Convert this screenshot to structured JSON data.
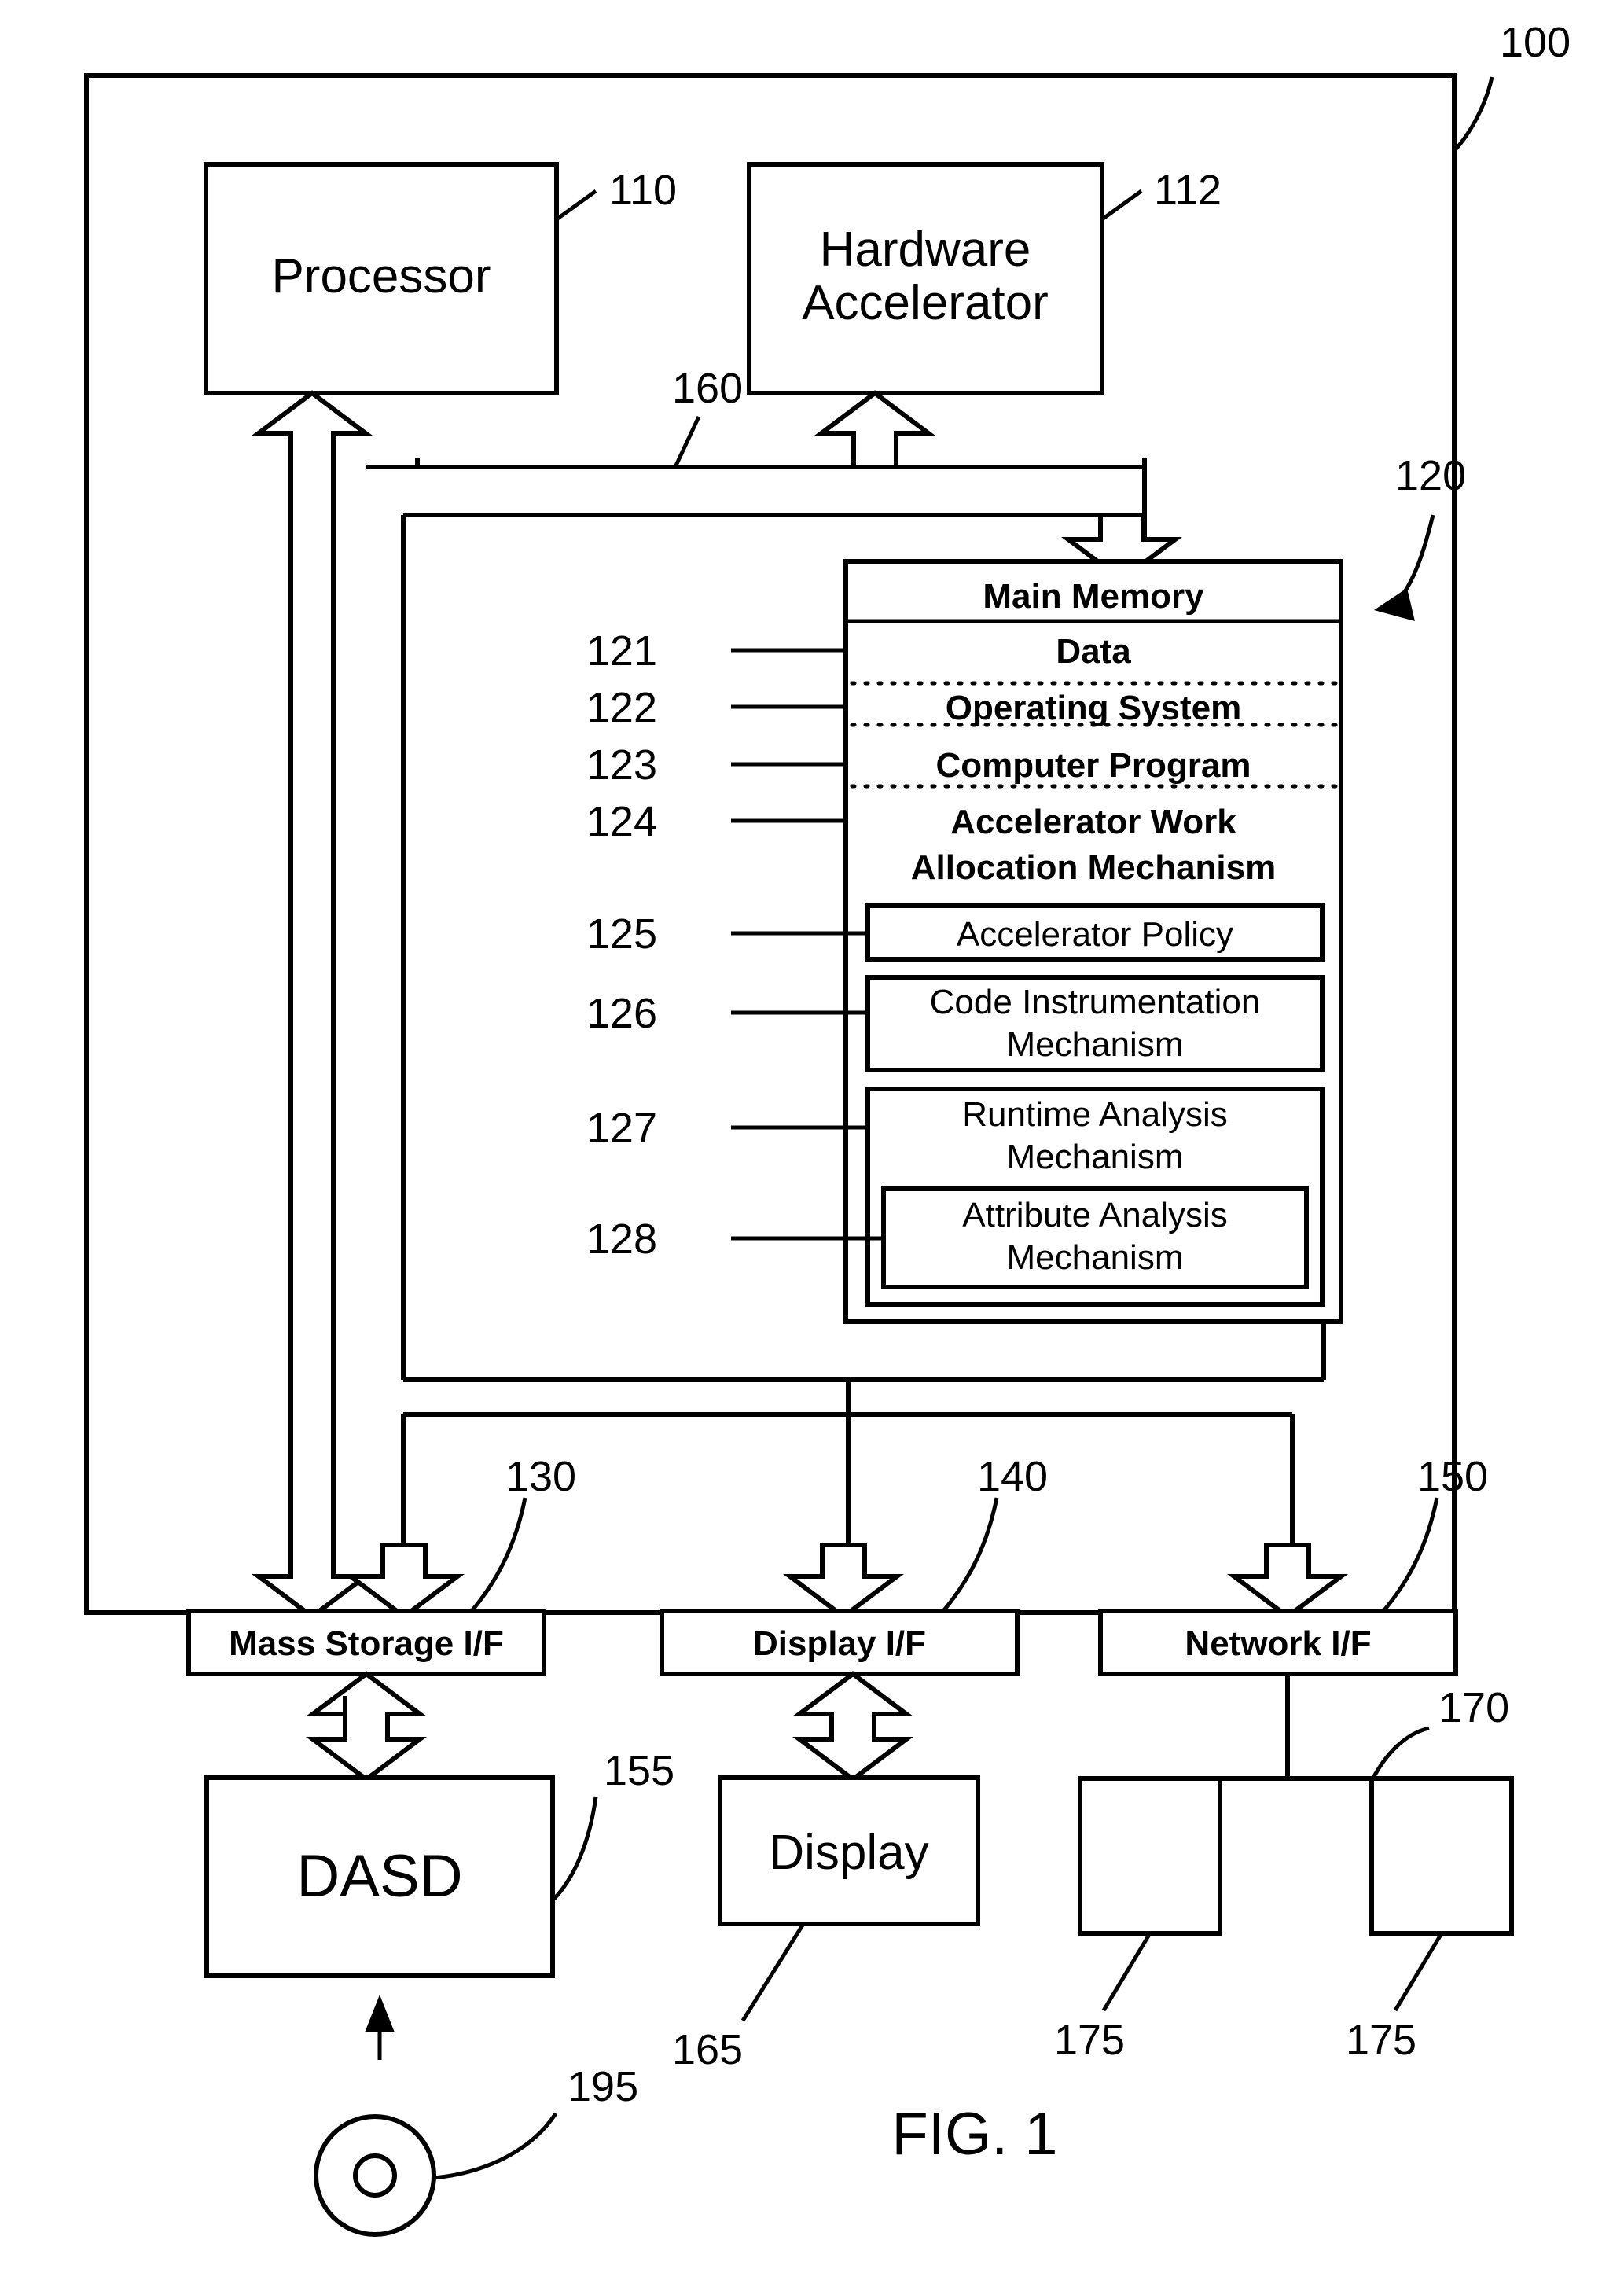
{
  "figure": {
    "caption": "FIG. 1",
    "system_ref": "100"
  },
  "blocks": {
    "processor": {
      "label": "Processor",
      "ref": "110"
    },
    "accelerator": {
      "label_line1": "Hardware",
      "label_line2": "Accelerator",
      "ref": "112"
    },
    "bus": {
      "ref": "160"
    },
    "main_memory": {
      "title": "Main Memory",
      "ref": "120",
      "items": [
        {
          "ref": "121",
          "label": "Data"
        },
        {
          "ref": "122",
          "label": "Operating System"
        },
        {
          "ref": "123",
          "label": "Computer Program"
        },
        {
          "ref": "124",
          "label_line1": "Accelerator Work",
          "label_line2": "Allocation Mechanism"
        },
        {
          "ref": "125",
          "label": "Accelerator Policy"
        },
        {
          "ref": "126",
          "label_line1": "Code Instrumentation",
          "label_line2": "Mechanism"
        },
        {
          "ref": "127",
          "label_line1": "Runtime Analysis",
          "label_line2": "Mechanism"
        },
        {
          "ref": "128",
          "label_line1": "Attribute Analysis",
          "label_line2": "Mechanism"
        }
      ]
    },
    "mass_storage_if": {
      "label": "Mass Storage I/F",
      "ref": "130"
    },
    "display_if": {
      "label": "Display I/F",
      "ref": "140"
    },
    "network_if": {
      "label": "Network I/F",
      "ref": "150"
    },
    "dasd": {
      "label": "DASD",
      "ref": "155"
    },
    "display": {
      "label": "Display",
      "ref": "165"
    },
    "network": {
      "ref": "170"
    },
    "network_node_left": {
      "ref": "175"
    },
    "network_node_right": {
      "ref": "175"
    },
    "media": {
      "ref": "195"
    }
  },
  "colors": {
    "ink": "#000000",
    "paper": "#ffffff"
  }
}
